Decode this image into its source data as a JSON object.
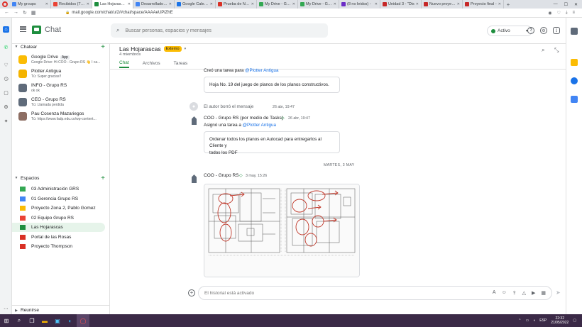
{
  "browser": {
    "tabs": [
      {
        "title": "My groups",
        "favcolor": "#4285f4",
        "active": false
      },
      {
        "title": "Recibidos (72) -",
        "favcolor": "#ea4335",
        "active": false
      },
      {
        "title": "Las Hojarascas",
        "favcolor": "#1e8e3e",
        "active": true
      },
      {
        "title": "Desarrolladores -",
        "favcolor": "#4285f4",
        "active": false
      },
      {
        "title": "Google Calendar",
        "favcolor": "#1a73e8",
        "active": false
      },
      {
        "title": "Prueba de Nue...",
        "favcolor": "#d93025",
        "active": false
      },
      {
        "title": "My Drive - Goo",
        "favcolor": "#34a853",
        "active": false
      },
      {
        "title": "My Drive - Goog",
        "favcolor": "#34a853",
        "active": false
      },
      {
        "title": "(8 no leidos) -",
        "favcolor": "#6c2dc7",
        "active": false
      },
      {
        "title": "Unidad 3 - \"Dis",
        "favcolor": "#c62828",
        "active": false
      },
      {
        "title": "Nuevo proyecto",
        "favcolor": "#c62828",
        "active": false
      },
      {
        "title": "Proyecto final -",
        "favcolor": "#c62828",
        "active": false
      }
    ],
    "url": "mail.google.com/chat/u/2/#chat/space/AAAAeUPiZhE"
  },
  "header": {
    "app_title": "Chat",
    "search_placeholder": "Buscar personas, espacios y mensajes",
    "status_label": "Activo"
  },
  "sidebar": {
    "chat_section_label": "Chatear",
    "dms": [
      {
        "name": "Google Drive",
        "badge": "App",
        "sub": "Google Drive: Hi COO - Grupo RS 👋 I ca...",
        "color": "#fbbc04"
      },
      {
        "name": "Plotter Antigua",
        "badge": "",
        "sub": "Tú: Super gracias!!",
        "color": "#f4b400"
      },
      {
        "name": "INFO - Grupo RS",
        "badge": "",
        "sub": "ok ok",
        "color": "#5f6b7a"
      },
      {
        "name": "CEO - Grupo RS",
        "badge": "",
        "sub": "Tú: Llamada perdida",
        "color": "#5f6b7a"
      },
      {
        "name": "Pau Cosenza Mazariegos",
        "badge": "",
        "sub": "Tú: https://www.fadp.edu.co/wp-content...",
        "color": "#8d6e63"
      }
    ],
    "spaces_section_label": "Espacios",
    "spaces": [
      {
        "name": "03 Administración GRS",
        "color": "#34a853"
      },
      {
        "name": "01 Gerencia Grupo RS",
        "color": "#4285f4"
      },
      {
        "name": "Proyecto Zona 2, Pablo Gomez",
        "color": "#fbbc04"
      },
      {
        "name": "02 Equipo Grupo RS",
        "color": "#ea4335"
      },
      {
        "name": "Las Hojarascas",
        "color": "#1e8e3e"
      },
      {
        "name": "Portal de las Rosas",
        "color": "#d93025"
      },
      {
        "name": "Proyecto Thompson",
        "color": "#d93025"
      }
    ],
    "meet_label": "Reunirse"
  },
  "room": {
    "title": "Las Hojarascas",
    "badge": "Externo",
    "members": "4 miembros",
    "tabs": [
      "Chat",
      "Archivos",
      "Tareas"
    ]
  },
  "messages": {
    "m1_text_pre": "Creó una tarea para ",
    "m1_mention": "@Plotter Antigua",
    "m1_card": "Hoja No. 19 del juego de planos de los planos constructivos.",
    "m2_text": "El autor borró el mensaje",
    "m2_time": "26 abr, 19:47",
    "m3_sender": "COO - Grupo RS (por medio de Tasks)",
    "m3_time": "26 abr, 19:47",
    "m3_text_pre": "Asignó una tarea a ",
    "m3_mention": "@Plotter Antigua",
    "m3_card_line1": "Ordenar todos los planos en Autocad para entregarlos al Cliente y",
    "m3_card_line2": "todos los PDF",
    "date_divider": "MARTES, 3 MAY",
    "m4_sender": "COO - Grupo RS",
    "m4_time": "3 may, 15:26"
  },
  "composer": {
    "placeholder": "El historial está activado"
  },
  "taskbar": {
    "lang": "ESP",
    "time": "22:32",
    "date": "21/05/2022"
  }
}
